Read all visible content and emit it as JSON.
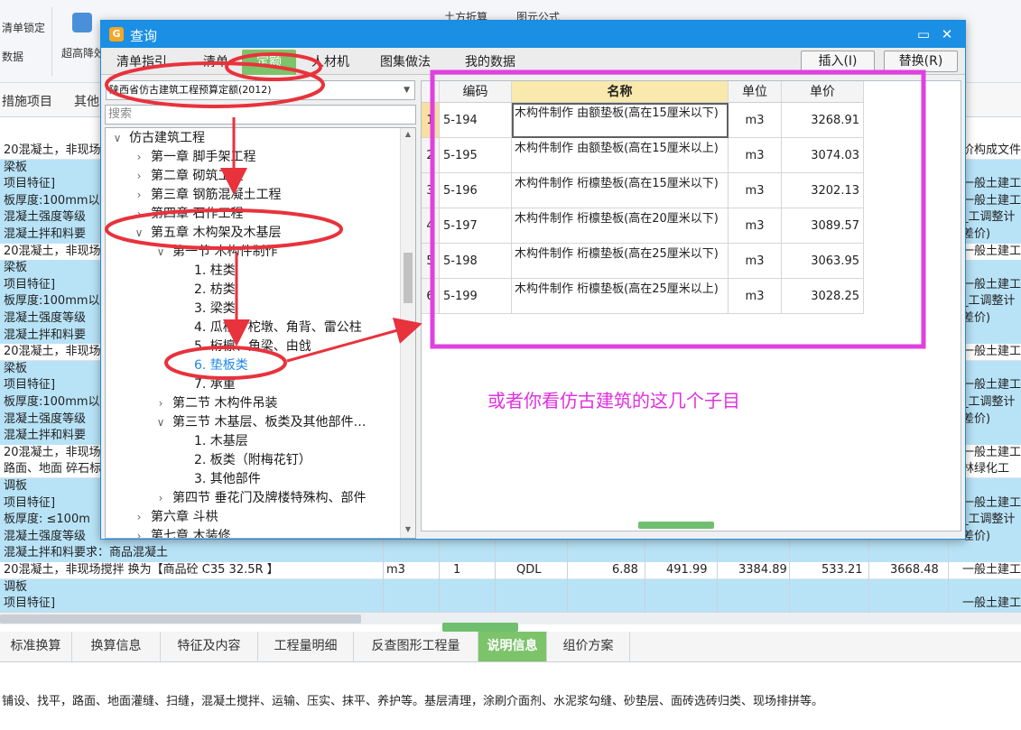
{
  "toolbar": {
    "item1": "清单锁定",
    "item2": "数据",
    "item3": "超高降效",
    "item4": "土方折算",
    "item5": "图元公式"
  },
  "tabstrip": {
    "tab1": "措施项目",
    "tab2": "其他"
  },
  "grid": {
    "rows_left": [
      {
        "text": "20混凝土，非现场",
        "style": "white"
      },
      {
        "text": "梁板",
        "style": "blue"
      },
      {
        "text": "项目特征]",
        "style": "blue"
      },
      {
        "text": "板厚度:100mm以",
        "style": "blue"
      },
      {
        "text": "混凝土强度等级",
        "style": "blue"
      },
      {
        "text": "混凝土拌和料要",
        "style": "blue"
      },
      {
        "text": "20混凝土，非现场",
        "style": "white"
      },
      {
        "text": "梁板",
        "style": "blue"
      },
      {
        "text": "项目特征]",
        "style": "blue"
      },
      {
        "text": "板厚度:100mm以",
        "style": "blue"
      },
      {
        "text": "混凝土强度等级",
        "style": "blue"
      },
      {
        "text": "混凝土拌和料要",
        "style": "blue"
      },
      {
        "text": "20混凝土，非现场",
        "style": "white"
      },
      {
        "text": "梁板",
        "style": "blue"
      },
      {
        "text": "项目特征]",
        "style": "blue"
      },
      {
        "text": "板厚度:100mm以",
        "style": "blue"
      },
      {
        "text": "混凝土强度等级",
        "style": "blue"
      },
      {
        "text": "混凝土拌和料要",
        "style": "blue"
      },
      {
        "text": "20混凝土，非现场",
        "style": "white"
      },
      {
        "text": "路面、地面 碎石标",
        "style": "white"
      },
      {
        "text": "调板",
        "style": "blue"
      },
      {
        "text": "项目特征]",
        "style": "blue"
      },
      {
        "text": "板厚度: ≤100m",
        "style": "blue"
      },
      {
        "text": "混凝土强度等级",
        "style": "blue"
      },
      {
        "text": "混凝土拌和料要求：商品混凝土",
        "style": "blue"
      },
      {
        "text": "20混凝土，非现场搅拌   换为【商品砼 C35 32.5R 】",
        "style": "white"
      },
      {
        "text": "调板",
        "style": "blue"
      },
      {
        "text": "项目特征]",
        "style": "blue"
      }
    ],
    "rows_right": [
      "价构成文件",
      "",
      "一般土建工",
      "一般土建工程",
      "_工调整计",
      "差价)",
      "一般土建工",
      "",
      "一般土建工程",
      "_工调整计",
      "差价)",
      "",
      "一般土建工",
      "",
      "一般土建工程",
      "_工调整计",
      "差价)",
      "",
      "一般土建工",
      "林绿化工",
      "",
      "一般土建工程",
      "_工调整计",
      "差价)",
      "",
      "一般土建工",
      "",
      "一般土建工程"
    ],
    "highlight_row": {
      "unit": "m3",
      "qty": "1",
      "code": "QDL",
      "v1": "6.88",
      "v2": "491.99",
      "v3": "3384.89",
      "v4": "533.21",
      "v5": "3668.48"
    }
  },
  "bottom_tabs": [
    "标准换算",
    "换算信息",
    "特征及内容",
    "工程量明细",
    "反查图形工程量",
    "说明信息",
    "组价方案"
  ],
  "bottom_desc": "铺设、找平，路面、地面灌缝、扫缝，混凝土搅拌、运输、压实、抹平、养护等。基层清理，涂刷介面剂、水泥浆勾缝、砂垫层、面砖选砖归类、现场排拼等。",
  "dialog": {
    "title": "查询",
    "logo": "G",
    "tabs": [
      "清单指引",
      "清单",
      "定额",
      "人材机",
      "图集做法",
      "我的数据"
    ],
    "active_tab": 2,
    "insert_btn": "插入(I)",
    "replace_btn": "替换(R)",
    "library_value": "陕西省仿古建筑工程预算定额(2012)",
    "search_placeholder": "搜索",
    "tree": [
      {
        "label": "仿古建筑工程",
        "level": 0,
        "toggle": "∨"
      },
      {
        "label": "第一章  脚手架工程",
        "level": 1,
        "toggle": "›"
      },
      {
        "label": "第二章  砌筑工程",
        "level": 1,
        "toggle": "›"
      },
      {
        "label": "第三章  钢筋混凝土工程",
        "level": 1,
        "toggle": "›"
      },
      {
        "label": "第四章  石作工程",
        "level": 1,
        "toggle": "›"
      },
      {
        "label": "第五章  木构架及木基层",
        "level": 1,
        "toggle": "∨"
      },
      {
        "label": "第一节  木构件制作",
        "level": 2,
        "toggle": "∨"
      },
      {
        "label": "1.  柱类",
        "level": 3,
        "toggle": ""
      },
      {
        "label": "2.  枋类",
        "level": 3,
        "toggle": ""
      },
      {
        "label": "3.  梁类",
        "level": 3,
        "toggle": ""
      },
      {
        "label": "4.  瓜柱、柁墩、角背、雷公柱",
        "level": 3,
        "toggle": ""
      },
      {
        "label": "5.  桁檩、角梁、由戗",
        "level": 3,
        "toggle": ""
      },
      {
        "label": "6.  垫板类",
        "level": 3,
        "toggle": "",
        "selected": true
      },
      {
        "label": "7.  承重",
        "level": 3,
        "toggle": ""
      },
      {
        "label": "第二节  木构件吊装",
        "level": 2,
        "toggle": "›"
      },
      {
        "label": "第三节  木基层、板类及其他部件…",
        "level": 2,
        "toggle": "∨"
      },
      {
        "label": "1.  木基层",
        "level": 3,
        "toggle": ""
      },
      {
        "label": "2.  板类（附梅花钉）",
        "level": 3,
        "toggle": ""
      },
      {
        "label": "3.  其他部件",
        "level": 3,
        "toggle": ""
      },
      {
        "label": "第四节  垂花门及牌楼特殊构、部件",
        "level": 2,
        "toggle": "›"
      },
      {
        "label": "第六章  斗栱",
        "level": 1,
        "toggle": "›"
      },
      {
        "label": "第七章  木装修",
        "level": 1,
        "toggle": "›"
      }
    ],
    "table": {
      "headers": {
        "code": "编码",
        "name": "名称",
        "unit": "单位",
        "price": "单价"
      },
      "rows": [
        {
          "idx": "1",
          "code": "5-194",
          "name": "木构件制作  由额垫板(高在15厘米以下)",
          "unit": "m3",
          "price": "3268.91"
        },
        {
          "idx": "2",
          "code": "5-195",
          "name": "木构件制作  由额垫板(高在15厘米以上)",
          "unit": "m3",
          "price": "3074.03"
        },
        {
          "idx": "3",
          "code": "5-196",
          "name": "木构件制作  桁檩垫板(高在15厘米以下)",
          "unit": "m3",
          "price": "3202.13"
        },
        {
          "idx": "4",
          "code": "5-197",
          "name": "木构件制作  桁檩垫板(高在20厘米以下)",
          "unit": "m3",
          "price": "3089.57"
        },
        {
          "idx": "5",
          "code": "5-198",
          "name": "木构件制作  桁檩垫板(高在25厘米以下)",
          "unit": "m3",
          "price": "3063.95"
        },
        {
          "idx": "6",
          "code": "5-199",
          "name": "木构件制作  桁檩垫板(高在25厘米以上)",
          "unit": "m3",
          "price": "3028.25"
        }
      ]
    }
  },
  "annotation": {
    "text": "或者你看仿古建筑的这几个子目",
    "color": "#e030e0",
    "circle_color": "#e8323c"
  }
}
